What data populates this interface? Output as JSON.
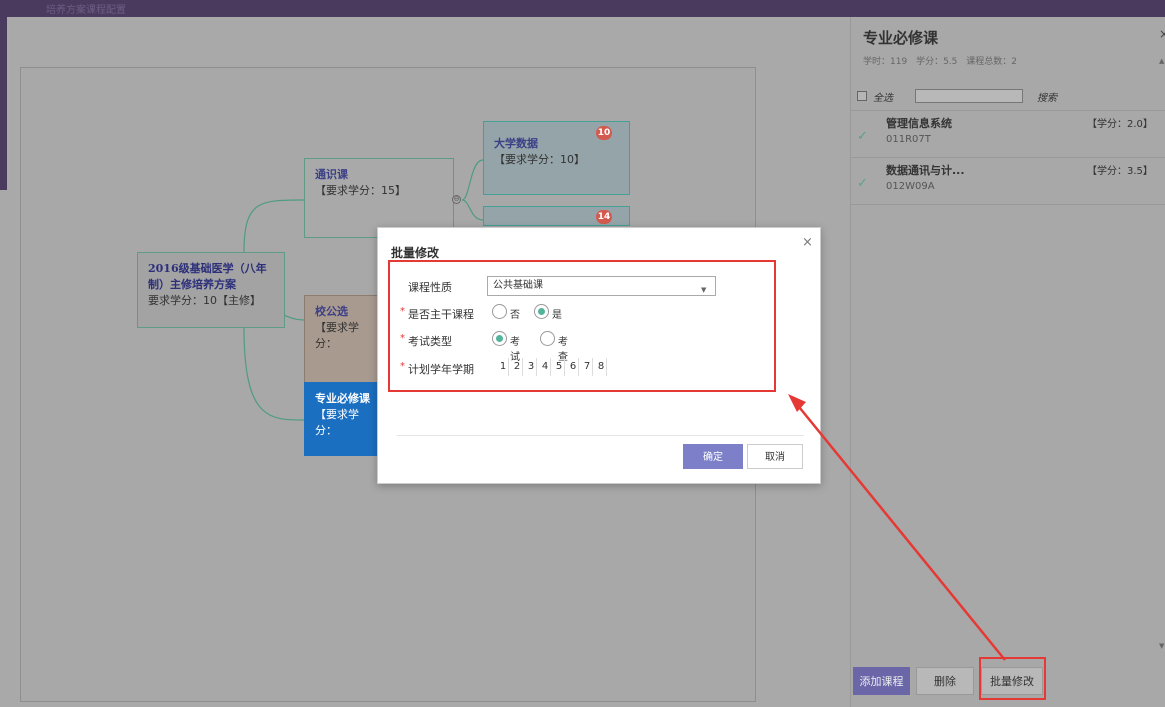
{
  "app": {
    "window_title": "培养方案课程配置"
  },
  "mindmap": {
    "root": {
      "title": "2016级基础医学（八年制）主修培养方案",
      "sub": "要求学分：10【主修】"
    },
    "general": {
      "title": "通识课",
      "sub": "【要求学分：15】"
    },
    "university": {
      "title": "校公选",
      "sub": "【要求学分："
    },
    "major": {
      "title": "专业必修课",
      "sub": "【要求学分："
    },
    "bigdata": {
      "title": "大学数据",
      "sub": "【要求学分：10】",
      "badge": "10"
    },
    "second": {
      "badge": "14"
    },
    "toggle_symbol": "⊖"
  },
  "side_panel": {
    "title": "专业必修课",
    "close": "×",
    "stats": {
      "hours": "学时：119",
      "credits": "学分：5.5",
      "course_total": "课程总数：2"
    },
    "select_all": "全选",
    "search_label": "搜索",
    "courses": [
      {
        "name": "管理信息系统",
        "code": "011R07T",
        "credit": "【学分：2.0】"
      },
      {
        "name": "数据通讯与计...",
        "code": "012W09A",
        "credit": "【学分：3.5】"
      }
    ],
    "buttons": {
      "add": "添加课程",
      "delete": "删除",
      "batch_edit": "批量修改"
    }
  },
  "modal": {
    "title": "批量修改",
    "close": "×",
    "course_type": {
      "label": "课程性质",
      "value": "公共基础课"
    },
    "is_main": {
      "label": "是否主干课程",
      "options": [
        "否",
        "是"
      ],
      "selected": "是"
    },
    "exam_type": {
      "label": "考试类型",
      "options": [
        "考试",
        "考查"
      ],
      "selected": "考试"
    },
    "semester": {
      "label": "计划学年学期",
      "values": [
        "1",
        "2",
        "3",
        "4",
        "5",
        "6",
        "7",
        "8"
      ]
    },
    "required_mark": "*",
    "buttons": {
      "confirm": "确定",
      "cancel": "取消"
    }
  },
  "colors": {
    "accent": "#7d80c8",
    "highlight": "#e53935",
    "radio_checked": "#52b49b",
    "major_node": "#1b6fc0"
  }
}
